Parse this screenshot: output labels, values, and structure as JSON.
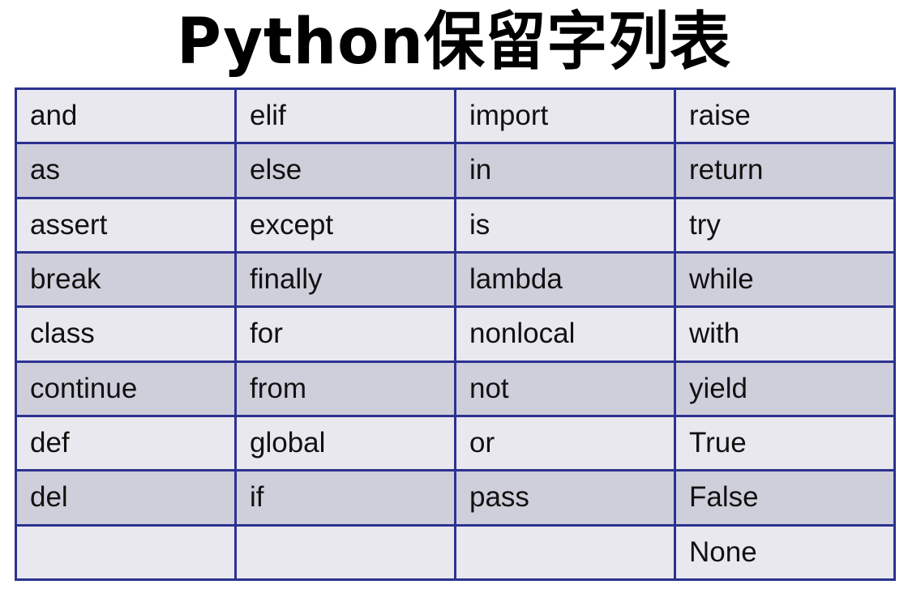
{
  "title": "Python保留字列表",
  "colors": {
    "border": "#2c3290",
    "row_light": "#e8e8ee",
    "row_dark": "#cfcfdc",
    "text": "#111111"
  },
  "table": {
    "rows": [
      [
        "and",
        "elif",
        "import",
        "raise"
      ],
      [
        "as",
        "else",
        "in",
        "return"
      ],
      [
        "assert",
        "except",
        "is",
        "try"
      ],
      [
        "break",
        "finally",
        "lambda",
        "while"
      ],
      [
        "class",
        "for",
        "nonlocal",
        "with"
      ],
      [
        "continue",
        "from",
        "not",
        "yield"
      ],
      [
        "def",
        "global",
        "or",
        "True"
      ],
      [
        "del",
        "if",
        "pass",
        "False"
      ],
      [
        "",
        "",
        "",
        "None"
      ]
    ]
  }
}
